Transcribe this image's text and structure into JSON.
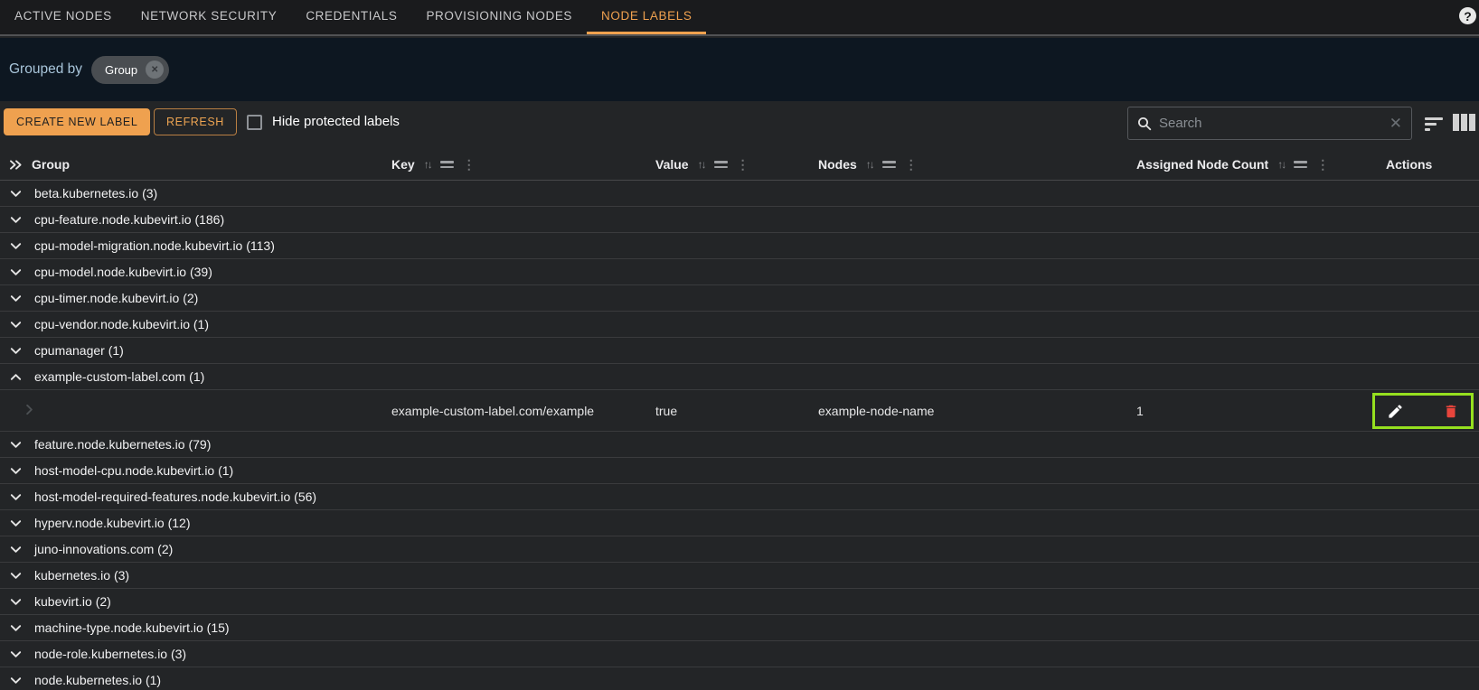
{
  "tabs": [
    {
      "label": "ACTIVE NODES",
      "active": false
    },
    {
      "label": "NETWORK SECURITY",
      "active": false
    },
    {
      "label": "CREDENTIALS",
      "active": false
    },
    {
      "label": "PROVISIONING NODES",
      "active": false
    },
    {
      "label": "NODE LABELS",
      "active": true
    }
  ],
  "help": {
    "glyph": "?"
  },
  "grouped_by": {
    "label": "Grouped by",
    "chip": "Group",
    "remove_glyph": "✕"
  },
  "toolbar": {
    "create_button": "CREATE NEW LABEL",
    "refresh_button": "REFRESH",
    "hide_protected_label": "Hide protected labels",
    "hide_protected_checked": false,
    "search": {
      "value": "",
      "placeholder": "Search",
      "clear_glyph": "✕"
    }
  },
  "header_icons": {
    "sort_glyph": "↑↓",
    "kebab_glyph": "⋮"
  },
  "table": {
    "headers": {
      "group": "Group",
      "key": "Key",
      "value": "Value",
      "nodes": "Nodes",
      "assigned_node_count": "Assigned Node Count",
      "actions": "Actions"
    },
    "groups": [
      {
        "name": "beta.kubernetes.io",
        "count": 3,
        "expanded": false
      },
      {
        "name": "cpu-feature.node.kubevirt.io",
        "count": 186,
        "expanded": false
      },
      {
        "name": "cpu-model-migration.node.kubevirt.io",
        "count": 113,
        "expanded": false
      },
      {
        "name": "cpu-model.node.kubevirt.io",
        "count": 39,
        "expanded": false
      },
      {
        "name": "cpu-timer.node.kubevirt.io",
        "count": 2,
        "expanded": false
      },
      {
        "name": "cpu-vendor.node.kubevirt.io",
        "count": 1,
        "expanded": false
      },
      {
        "name": "cpumanager",
        "count": 1,
        "expanded": false
      },
      {
        "name": "example-custom-label.com",
        "count": 1,
        "expanded": true
      },
      {
        "name": "feature.node.kubernetes.io",
        "count": 79,
        "expanded": false
      },
      {
        "name": "host-model-cpu.node.kubevirt.io",
        "count": 1,
        "expanded": false
      },
      {
        "name": "host-model-required-features.node.kubevirt.io",
        "count": 56,
        "expanded": false
      },
      {
        "name": "hyperv.node.kubevirt.io",
        "count": 12,
        "expanded": false
      },
      {
        "name": "juno-innovations.com",
        "count": 2,
        "expanded": false
      },
      {
        "name": "kubernetes.io",
        "count": 3,
        "expanded": false
      },
      {
        "name": "kubevirt.io",
        "count": 2,
        "expanded": false
      },
      {
        "name": "machine-type.node.kubevirt.io",
        "count": 15,
        "expanded": false
      },
      {
        "name": "node-role.kubernetes.io",
        "count": 3,
        "expanded": false
      },
      {
        "name": "node.kubernetes.io",
        "count": 1,
        "expanded": false
      }
    ],
    "detail_row": {
      "key": "example-custom-label.com/example",
      "value": "true",
      "nodes": "example-node-name",
      "assigned_node_count": "1"
    }
  },
  "colors": {
    "accent_orange": "#efa14f",
    "band_bg": "#0d1721",
    "grouped_text": "#a8c5da",
    "highlight_green": "#96e01f",
    "danger_red": "#e8453c"
  }
}
